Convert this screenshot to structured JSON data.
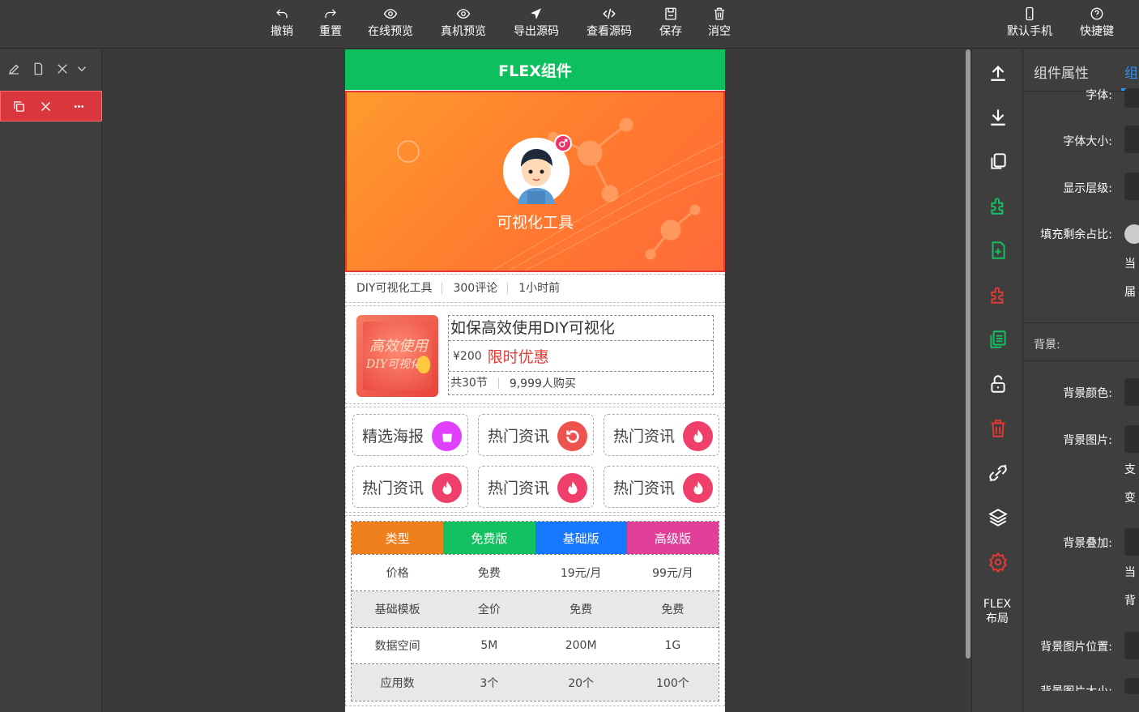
{
  "toolbar": {
    "undo": "撤销",
    "redo": "重置",
    "online_preview": "在线预览",
    "device_preview": "真机预览",
    "export_source": "导出源码",
    "view_source": "查看源码",
    "save": "保存",
    "clear": "消空",
    "default_phone": "默认手机",
    "shortcuts": "快捷键"
  },
  "phone": {
    "header_title": "FLEX组件",
    "hero": {
      "name": "可视化工具",
      "gender_icon": "male-icon"
    },
    "meta": [
      "DIY可视化工具",
      "300评论",
      "1小时前"
    ],
    "course": {
      "thumb_text_1": "高效使用",
      "thumb_text_2": "DIY可视化",
      "title": "如保高效使用DIY可视化",
      "price": "¥200",
      "promo": "限时优惠",
      "lessons": "共30节",
      "buyers": "9,999人购买"
    },
    "grid": [
      {
        "label": "精选海报",
        "icon": "bag-icon",
        "color": "#e040fb"
      },
      {
        "label": "热门资讯",
        "icon": "refresh-icon",
        "color": "#ef5350"
      },
      {
        "label": "热门资讯",
        "icon": "fire-icon",
        "color": "#ef3f6a"
      },
      {
        "label": "热门资讯",
        "icon": "fire-icon",
        "color": "#ef3f6a"
      },
      {
        "label": "热门资讯",
        "icon": "fire-icon",
        "color": "#ef3f6a"
      },
      {
        "label": "热门资讯",
        "icon": "fire-icon",
        "color": "#ef3f6a"
      }
    ],
    "pricing": {
      "headers": [
        {
          "label": "类型",
          "color": "#f07f1e"
        },
        {
          "label": "免费版",
          "color": "#13c160"
        },
        {
          "label": "基础版",
          "color": "#1677ff"
        },
        {
          "label": "高级版",
          "color": "#e0409a"
        }
      ],
      "rows": [
        [
          "价格",
          "免费",
          "19元/月",
          "99元/月"
        ],
        [
          "基础模板",
          "全价",
          "免费",
          "免费"
        ],
        [
          "数据空间",
          "5M",
          "200M",
          "1G"
        ],
        [
          "应用数",
          "3个",
          "20个",
          "100个"
        ]
      ]
    }
  },
  "right_tools": {
    "flex_label_1": "FLEX",
    "flex_label_2": "布局"
  },
  "props": {
    "tab_component": "组件属性",
    "tab_other": "组",
    "font": "字体:",
    "font_size": "字体大小:",
    "z_index": "显示层级:",
    "fill_ratio": "填充剩余占比:",
    "note_a": "当",
    "note_b": "届",
    "background_section": "背景:",
    "bg_color": "背景颜色:",
    "bg_image": "背景图片:",
    "note_c": "支",
    "note_d": "变",
    "bg_overlay": "背景叠加:",
    "note_e": "当",
    "note_f": "背",
    "bg_position": "背景图片位置:",
    "bg_size": "背景图片大小:"
  }
}
